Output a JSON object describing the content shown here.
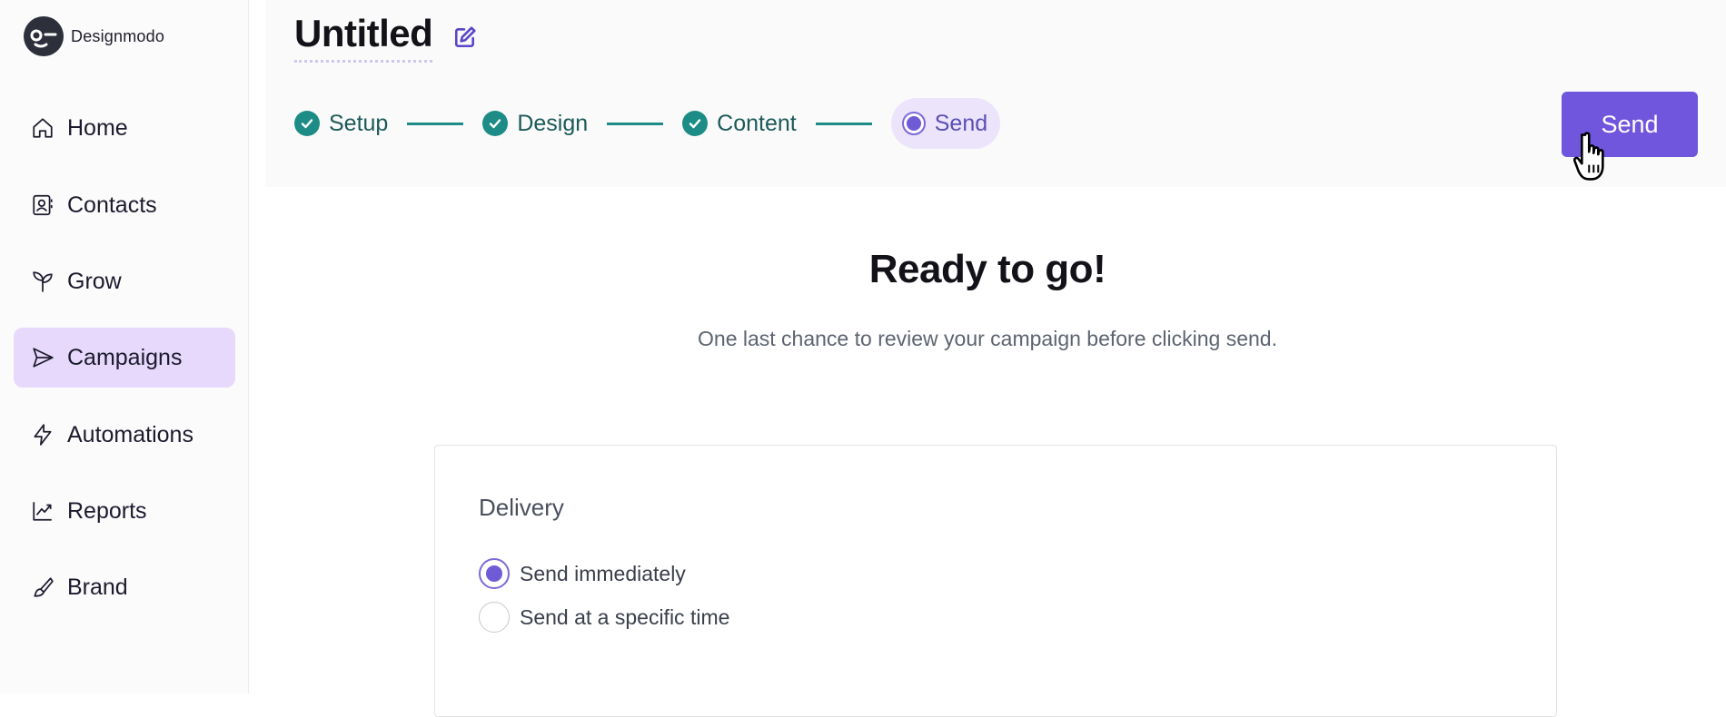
{
  "brand": {
    "name": "Designmodo"
  },
  "sidebar": {
    "items": [
      {
        "label": "Home",
        "icon": "home-icon",
        "active": false
      },
      {
        "label": "Contacts",
        "icon": "contacts-icon",
        "active": false
      },
      {
        "label": "Grow",
        "icon": "sprout-icon",
        "active": false
      },
      {
        "label": "Campaigns",
        "icon": "send-icon",
        "active": true
      },
      {
        "label": "Automations",
        "icon": "lightning-icon",
        "active": false
      },
      {
        "label": "Reports",
        "icon": "chart-line-icon",
        "active": false
      },
      {
        "label": "Brand",
        "icon": "brush-icon",
        "active": false
      }
    ]
  },
  "header": {
    "title": "Untitled",
    "steps": [
      {
        "label": "Setup",
        "status": "complete"
      },
      {
        "label": "Design",
        "status": "complete"
      },
      {
        "label": "Content",
        "status": "complete"
      },
      {
        "label": "Send",
        "status": "current"
      }
    ],
    "send_label": "Send"
  },
  "main": {
    "heading": "Ready to go!",
    "subheading": "One last chance to review your campaign before clicking send.",
    "delivery": {
      "title": "Delivery",
      "options": [
        {
          "label": "Send immediately",
          "selected": true
        },
        {
          "label": "Send at a specific time",
          "selected": false
        }
      ]
    }
  },
  "colors": {
    "accent": "#6f56dc",
    "step_complete": "#1e8c86",
    "active_nav_bg": "#e6d9fb"
  }
}
